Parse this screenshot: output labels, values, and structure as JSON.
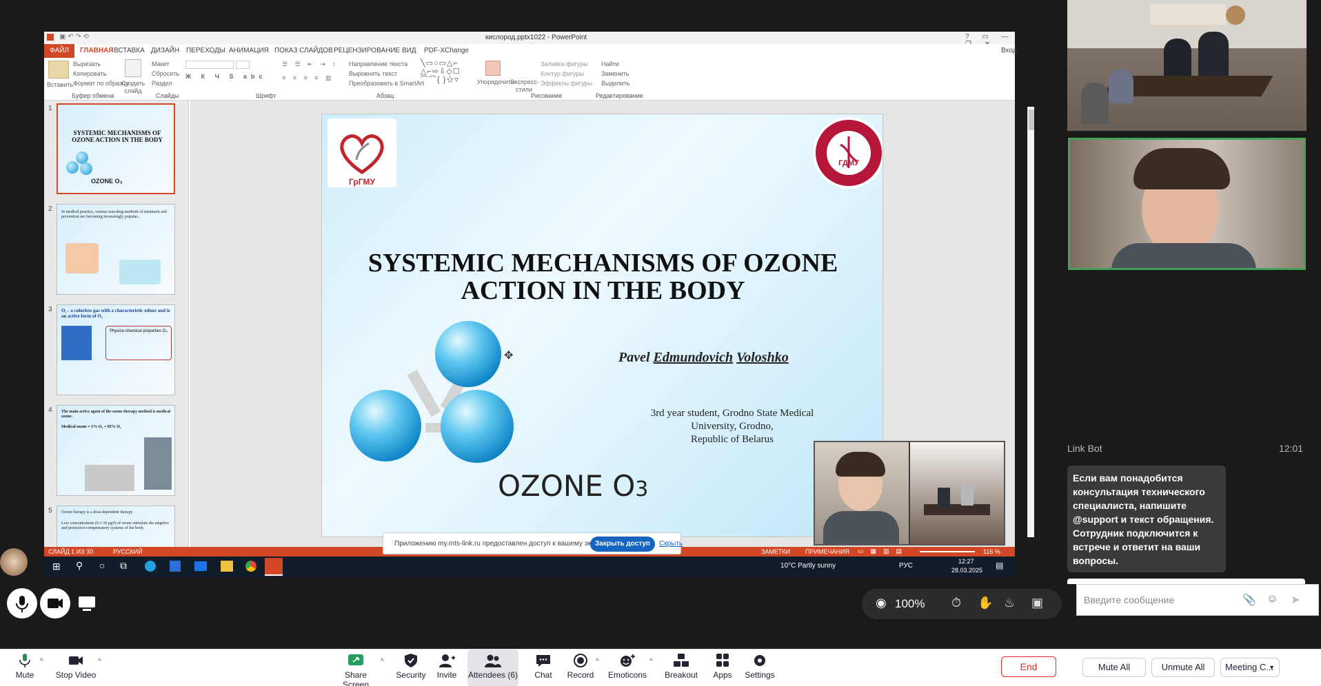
{
  "powerpoint": {
    "window_title": "кислород.pptx1022 - PowerPoint",
    "login": "Вход",
    "tabs": [
      "ФАЙЛ",
      "ГЛАВНАЯ",
      "ВСТАВКА",
      "ДИЗАЙН",
      "ПЕРЕХОДЫ",
      "АНИМАЦИЯ",
      "ПОКАЗ СЛАЙДОВ",
      "РЕЦЕНЗИРОВАНИЕ",
      "ВИД",
      "PDF-XChange"
    ],
    "ribbon": {
      "paste": "Вставить",
      "cut": "Вырезать",
      "copy": "Копировать",
      "format_painter": "Формат по образцу",
      "new_slide": "Создать слайд",
      "layout": "Макет",
      "reset": "Сбросить",
      "section": "Раздел",
      "text_direction": "Направление текста",
      "align_text": "Выровнять текст",
      "smartart": "Преобразовать в SmartArt",
      "arrange": "Упорядочить",
      "quick_styles": "Экспресс-стили",
      "shape_fill": "Заливка фигуры",
      "shape_outline": "Контур фигуры",
      "shape_effects": "Эффекты фигуры",
      "find": "Найти",
      "replace": "Заменить",
      "select": "Выделить",
      "groups": [
        "Буфер обмена",
        "Слайды",
        "Шрифт",
        "Абзац",
        "Рисование",
        "Редактирование"
      ]
    },
    "thumbnails": [
      {
        "num": "1",
        "title": "SYSTEMIC MECHANISMS OF OZONE ACTION IN THE BODY",
        "sub": "OZONE O₃"
      },
      {
        "num": "2",
        "title": "In medical practice, various non-drug methods of treatment and prevention are becoming increasingly popular...",
        "sub": ""
      },
      {
        "num": "3",
        "title": "O₃ - a colorless gas with a characteristic odour and is an active form of O₂",
        "sub": "Physico-chemical properties O₃"
      },
      {
        "num": "4",
        "title": "The main active agent of the ozone therapy method is medical ozone.",
        "sub": "Medical ozone = 5% O₃ + 95% O₂"
      },
      {
        "num": "5",
        "title": "Ozone therapy is a dose-dependent therapy",
        "sub": "Low concentrations (0.1-10 μg/l) of ozone stimulate the adaptive and protective-compensatory systems of the body."
      }
    ],
    "slide": {
      "title_line1": "SYSTEMIC MECHANISMS OF OZONE",
      "title_line2": "ACTION IN THE BODY",
      "author_first": "Pavel",
      "author_mid": "Edmundovich",
      "author_last": "Voloshko",
      "affil1": "3rd  year student, Grodno State Medical",
      "affil2": "University, Grodno,",
      "affil3": "Republic of Belarus",
      "ozone": "OZONE O",
      "ozone_sub": "3",
      "logo_left_text": "ГрГМУ",
      "logo_right_text": "ГДМУ"
    },
    "status": {
      "slide_count": "СЛАЙД 1 ИЗ 30",
      "language": "РУССКИЙ",
      "notes": "ЗАМЕТКИ",
      "comments": "ПРИМЕЧАНИЯ",
      "zoom": "116 %"
    },
    "share_banner": {
      "text": "Приложению my.mts-link.ru предоставлен доступ к вашему экрану.",
      "allow": "Закрыть доступ",
      "hide": "Скрыть"
    },
    "taskbar": {
      "weather": "10°C  Partly sunny",
      "lang": "РУС",
      "time": "12:27",
      "date": "28.03.2025"
    }
  },
  "overlay": {
    "view_zoom": "100%"
  },
  "chat": {
    "sender": "Link Bot",
    "time": "12:01",
    "message": "Если вам понадобится консультация технического специалиста, напишите @support и текст обращения. Сотрудник подключится к встрече и ответит на ваши вопросы.",
    "placeholder": "Введите сообщение"
  },
  "toolbar": {
    "mute": "Mute",
    "stop_video": "Stop Video",
    "share_screen": "Share Screen",
    "security": "Security",
    "invite": "Invite",
    "attendees": "Attendees (6)",
    "chat": "Chat",
    "record": "Record",
    "emoticons": "Emoticons",
    "breakout": "Breakout",
    "apps": "Apps",
    "settings": "Settings",
    "end": "End",
    "mute_all": "Mute All",
    "unmute_all": "Unmute All",
    "meeting_controls": "Meeting C..."
  },
  "colors": {
    "ppt_accent": "#d24726",
    "active_speaker_border": "#3fa35a",
    "end_red": "#e02828",
    "allow_blue": "#1565c0"
  }
}
